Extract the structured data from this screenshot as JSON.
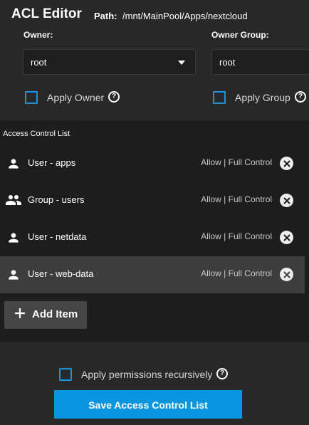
{
  "header": {
    "title": "ACL Editor",
    "path_label": "Path:",
    "path_value": "/mnt/MainPool/Apps/nextcloud"
  },
  "owner": {
    "label": "Owner:",
    "value": "root",
    "apply_label": "Apply Owner",
    "apply_checked": false
  },
  "owner_group": {
    "label": "Owner Group:",
    "value": "root",
    "apply_label": "Apply Group",
    "apply_checked": false
  },
  "acl": {
    "title": "Access Control List",
    "items": [
      {
        "icon": "user-icon",
        "label": "User - apps",
        "permission": "Allow | Full Control",
        "selected": false
      },
      {
        "icon": "group-icon",
        "label": "Group - users",
        "permission": "Allow | Full Control",
        "selected": false
      },
      {
        "icon": "user-icon",
        "label": "User - netdata",
        "permission": "Allow | Full Control",
        "selected": false
      },
      {
        "icon": "user-icon",
        "label": "User - web-data",
        "permission": "Allow | Full Control",
        "selected": true
      }
    ],
    "add_item_label": "Add Item"
  },
  "footer": {
    "recursive_label": "Apply permissions recursively",
    "recursive_checked": false,
    "save_label": "Save Access Control List"
  },
  "colors": {
    "accent": "#0a95e0",
    "checkbox_border": "#1e90d6",
    "background": "#282828",
    "panel": "#1d1d1d",
    "selected_row": "#3d3d3d"
  }
}
